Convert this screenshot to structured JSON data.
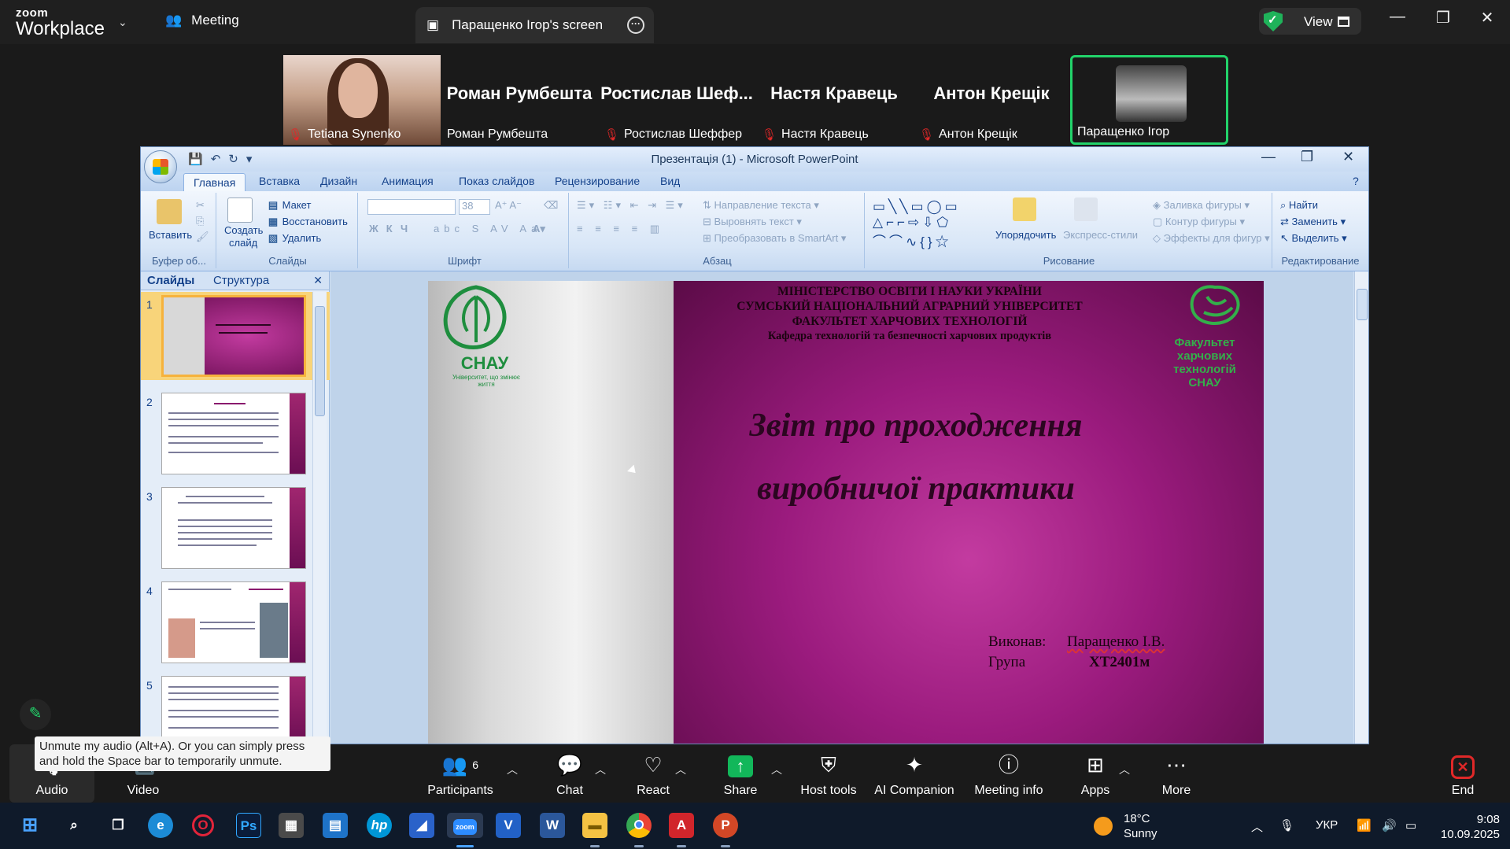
{
  "zoom": {
    "logo_top": "zoom",
    "logo_bottom": "Workplace",
    "tab_meeting": "Meeting",
    "tab_screen": "Паращенко Ігор's screen",
    "view_label": "View"
  },
  "participants": [
    {
      "name": "Tetiana Synenko",
      "big": "",
      "muted": true
    },
    {
      "name": "Роман Румбешта",
      "big": "Роман Румбешта",
      "muted": false
    },
    {
      "name": "Ростислав Шеффер",
      "big": "Ростислав Шеф...",
      "muted": true
    },
    {
      "name": "Настя Кравець",
      "big": "Настя Кравець",
      "muted": true
    },
    {
      "name": "Антон Крещік",
      "big": "Антон Крещік",
      "muted": true
    },
    {
      "name": "Паращенко Ігор",
      "big": "",
      "muted": false
    }
  ],
  "ppt": {
    "window_title": "Презентація (1) - Microsoft PowerPoint",
    "tabs": [
      "Главная",
      "Вставка",
      "Дизайн",
      "Анимация",
      "Показ слайдов",
      "Рецензирование",
      "Вид"
    ],
    "groups": {
      "clipboard": "Буфер об...",
      "slides": "Слайды",
      "font": "Шрифт",
      "paragraph": "Абзац",
      "drawing": "Рисование",
      "editing": "Редактирование"
    },
    "buttons": {
      "paste": "Вставить",
      "new_slide_1": "Создать",
      "new_slide_2": "слайд",
      "layout": "Макет",
      "reset": "Восстановить",
      "delete": "Удалить",
      "font_size": "38",
      "text_direction": "Направление текста",
      "align_text": "Выровнять текст",
      "smartart": "Преобразовать в SmartArt",
      "arrange": "Упорядочить",
      "quick_styles": "Экспресс-стили",
      "shape_fill": "Заливка фигуры",
      "shape_outline": "Контур фигуры",
      "shape_effects": "Эффекты для фигур",
      "find": "Найти",
      "replace": "Заменить",
      "select": "Выделить"
    },
    "pane_tabs": [
      "Слайды",
      "Структура"
    ],
    "slide_numbers": [
      "1",
      "2",
      "3",
      "4",
      "5"
    ],
    "slide": {
      "header": [
        "МІНІСТЕРСТВО ОСВІТИ І НАУКИ УКРАЇНИ",
        "СУМСЬКИЙ НАЦІОНАЛЬНИЙ АГРАРНИЙ УНІВЕРСИТЕТ",
        "ФАКУЛЬТЕТ ХАРЧОВИХ ТЕХНОЛОГІЙ"
      ],
      "department": "Кафедра технологій та безпечності харчових продуктів",
      "title_line1": "Звіт про проходження",
      "title_line2": "виробничої практики",
      "logo_name": "СНАУ",
      "logo_sub": "Університет, що змінює життя",
      "faculty_logo": [
        "Факультет харчових",
        "технологій",
        "СНАУ"
      ],
      "executor_label": "Виконав:",
      "executor_value": "Паращенко І.В.",
      "group_label": "Група",
      "group_value": "ХТ2401м"
    }
  },
  "controls": {
    "audio": "Audio",
    "video": "Video",
    "participants": "Participants",
    "participants_count": "6",
    "chat": "Chat",
    "react": "React",
    "share": "Share",
    "host_tools": "Host tools",
    "ai_companion": "AI Companion",
    "meeting_info": "Meeting info",
    "apps": "Apps",
    "more": "More",
    "end": "End",
    "tooltip": "Unmute my audio (Alt+A). Or you can simply press and hold the Space bar to temporarily unmute."
  },
  "taskbar": {
    "temperature": "18°C",
    "condition": "Sunny",
    "language": "УКР",
    "time": "9:08",
    "date": "10.09.2025",
    "apps": [
      "start-icon",
      "search-icon",
      "task-view-icon",
      "edge-icon",
      "opera-icon",
      "photoshop-icon",
      "calculator-icon",
      "store-icon",
      "hp-icon",
      "snipping-icon",
      "zoom-icon",
      "vpn-icon",
      "word-icon",
      "explorer-icon",
      "chrome-icon",
      "acrobat-icon",
      "powerpoint-icon"
    ]
  },
  "colors": {
    "zoom_green": "#22d36a",
    "share_green": "#12b75a",
    "end_red": "#e02828",
    "slide_magenta": "#9b1b7e",
    "snau_green": "#1e8e3e"
  }
}
